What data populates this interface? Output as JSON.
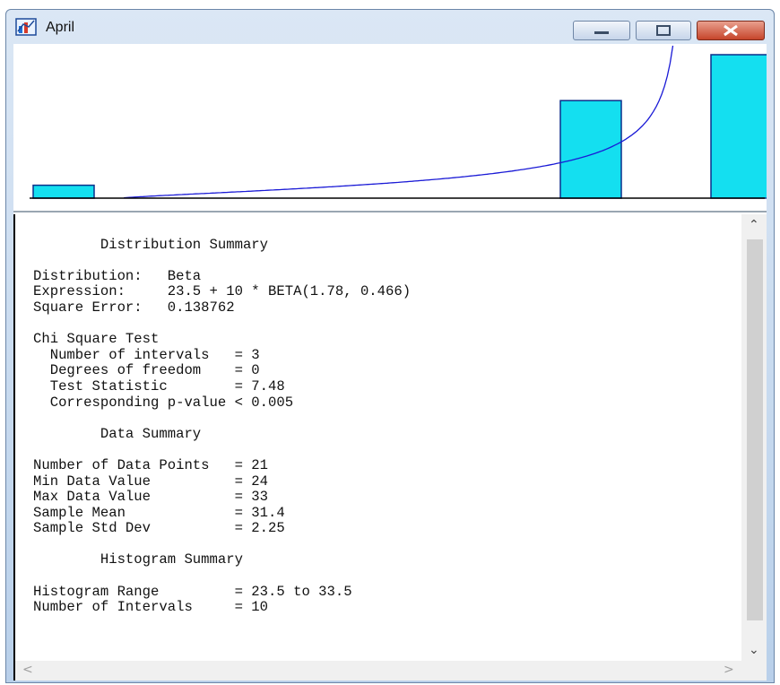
{
  "window": {
    "title": "April"
  },
  "controls": {
    "minimize": "minimize-icon",
    "maximize": "maximize-icon",
    "close": "close-icon"
  },
  "colors": {
    "bar_fill": "#14dff0",
    "bar_stroke": "#0a2f8a",
    "curve": "#1a1ad6",
    "axis": "#000000"
  },
  "chart_data": {
    "type": "bar",
    "description_free": true,
    "x_range": [
      23.5,
      33.5
    ],
    "bins": [
      {
        "x_start": 23.5,
        "x_end": 24.5,
        "relative_height": 0.09
      },
      {
        "x_start": 30.5,
        "x_end": 31.5,
        "relative_height": 0.68
      },
      {
        "x_start": 32.5,
        "x_end": 33.5,
        "relative_height": 1.0
      }
    ],
    "fitted_curve": "beta"
  },
  "report": {
    "lines": [
      "",
      "        Distribution Summary",
      "",
      "Distribution:   Beta",
      "Expression:     23.5 + 10 * BETA(1.78, 0.466)",
      "Square Error:   0.138762",
      "",
      "Chi Square Test",
      "  Number of intervals   = 3",
      "  Degrees of freedom    = 0",
      "  Test Statistic        = 7.48",
      "  Corresponding p-value < 0.005",
      "",
      "        Data Summary",
      "",
      "Number of Data Points   = 21",
      "Min Data Value          = 24",
      "Max Data Value          = 33",
      "Sample Mean             = 31.4",
      "Sample Std Dev          = 2.25",
      "",
      "        Histogram Summary",
      "",
      "Histogram Range         = 23.5 to 33.5",
      "Number of Intervals     = 10"
    ]
  }
}
